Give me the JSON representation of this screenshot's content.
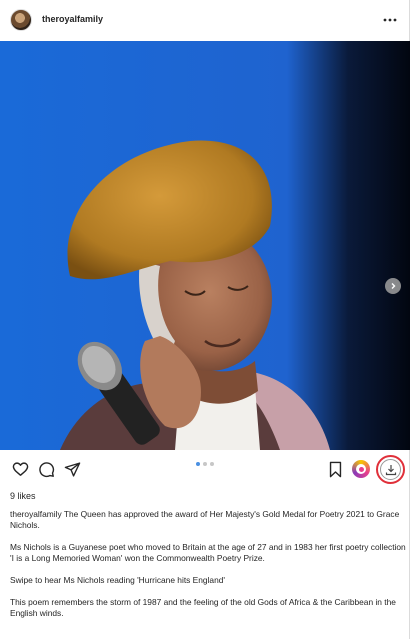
{
  "header": {
    "username": "theroyalfamily",
    "more_icon": "more-horizontal-icon"
  },
  "media": {
    "description_icon": "photo",
    "next_icon": "chevron-right-icon",
    "carousel": {
      "count": 3,
      "active_index": 0
    }
  },
  "actions": {
    "like_icon": "heart-icon",
    "comment_icon": "comment-icon",
    "share_icon": "send-icon",
    "save_icon": "bookmark-icon",
    "extension_icon": "extension-icon",
    "download_icon": "download-icon",
    "highlight_color": "#e0303a"
  },
  "likes": "9 likes",
  "caption": {
    "username": "theroyalfamily",
    "first_line": " The Queen has approved the award of Her Majesty's Gold Medal for Poetry 2021 to Grace Nichols.",
    "paragraph_2": "Ms Nichols is a Guyanese poet who moved to Britain at the age of 27 and in 1983 her first poetry collection 'I is a Long Memoried Woman' won the Commonwealth Poetry Prize.",
    "paragraph_3": "Swipe to hear Ms Nichols reading 'Hurricane hits England'",
    "paragraph_4": "This poem remembers the storm of 1987 and the feeling of the old Gods of Africa & the Caribbean in the English winds."
  }
}
